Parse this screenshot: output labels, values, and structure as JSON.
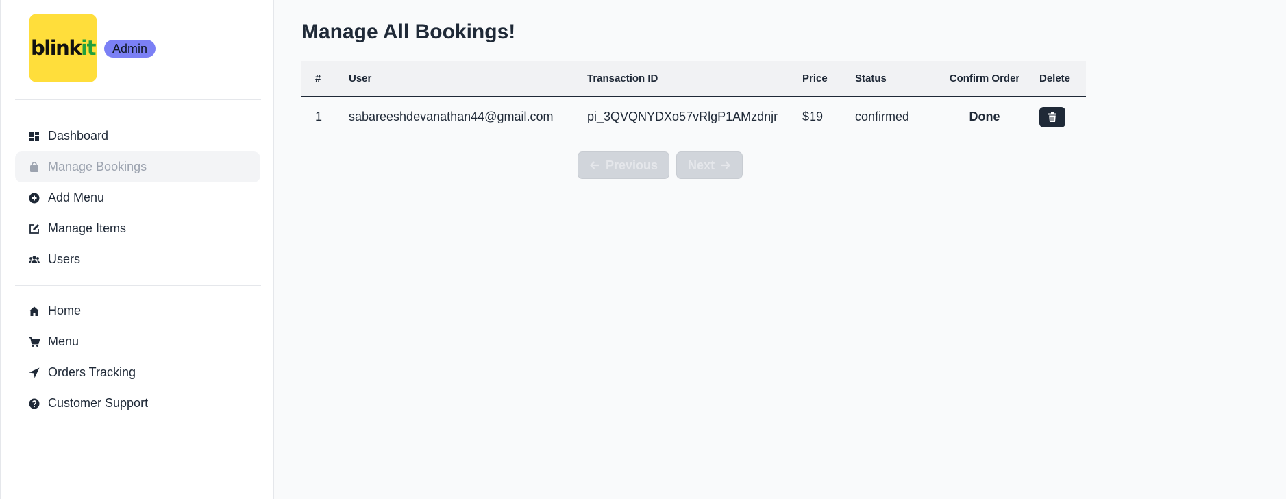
{
  "sidebar": {
    "logo_text_a": "blink",
    "logo_text_b": "it",
    "badge": "Admin",
    "admin_nav": [
      {
        "label": "Dashboard",
        "icon": "dashboard-icon"
      },
      {
        "label": "Manage Bookings",
        "icon": "shopping-bag-icon"
      },
      {
        "label": "Add Menu",
        "icon": "plus-circle-icon"
      },
      {
        "label": "Manage Items",
        "icon": "edit-icon"
      },
      {
        "label": "Users",
        "icon": "users-icon"
      }
    ],
    "site_nav": [
      {
        "label": "Home",
        "icon": "home-icon"
      },
      {
        "label": "Menu",
        "icon": "cart-icon"
      },
      {
        "label": "Orders Tracking",
        "icon": "location-arrow-icon"
      },
      {
        "label": "Customer Support",
        "icon": "question-circle-icon"
      }
    ],
    "active_item": "Manage Bookings"
  },
  "main": {
    "title": "Manage All Bookings!",
    "table": {
      "headers": [
        "#",
        "User",
        "Transaction ID",
        "Price",
        "Status",
        "Confirm Order",
        "Delete"
      ],
      "rows": [
        {
          "num": "1",
          "user": "sabareeshdevanathan44@gmail.com",
          "transaction_id": "pi_3QVQNYDXo57vRlgP1AMzdnjr",
          "price": "$19",
          "status": "confirmed",
          "confirm": "Done"
        }
      ]
    },
    "pagination": {
      "previous": "Previous",
      "next": "Next"
    }
  },
  "colors": {
    "logo_bg": "#ffde3b",
    "badge_bg": "#7b80f5",
    "delete_btn": "#1f2937"
  }
}
